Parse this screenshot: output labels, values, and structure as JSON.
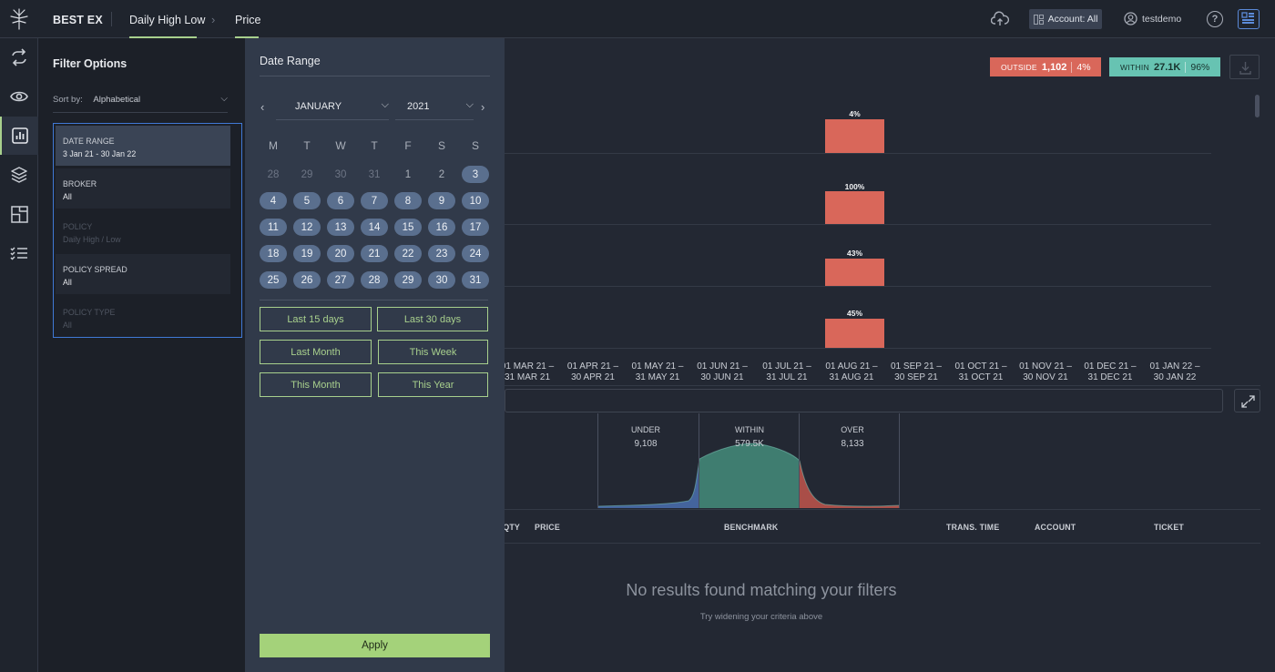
{
  "header": {
    "brand": "BEST EX",
    "breadcrumbs": [
      "Daily High Low",
      "Price"
    ],
    "account_label": "Account: All",
    "username": "testdemo",
    "help": "?"
  },
  "filter_panel": {
    "title": "Filter Options",
    "sort_label": "Sort by:",
    "sort_value": "Alphabetical",
    "items": [
      {
        "label": "DATE RANGE",
        "value": "3 Jan 21 - 30 Jan 22"
      },
      {
        "label": "BROKER",
        "value": "All"
      },
      {
        "label": "POLICY",
        "value": "Daily High / Low"
      },
      {
        "label": "POLICY SPREAD",
        "value": "All"
      },
      {
        "label": "POLICY TYPE",
        "value": "All"
      }
    ]
  },
  "date_range": {
    "title": "Date Range",
    "month": "JANUARY",
    "year": "2021",
    "weekdays": [
      "M",
      "T",
      "W",
      "T",
      "F",
      "S",
      "S"
    ],
    "weeks": [
      [
        "28",
        "29",
        "30",
        "31",
        "1",
        "2",
        "3"
      ],
      [
        "4",
        "5",
        "6",
        "7",
        "8",
        "9",
        "10"
      ],
      [
        "11",
        "12",
        "13",
        "14",
        "15",
        "16",
        "17"
      ],
      [
        "18",
        "19",
        "20",
        "21",
        "22",
        "23",
        "24"
      ],
      [
        "25",
        "26",
        "27",
        "28",
        "29",
        "30",
        "31"
      ]
    ],
    "quick": [
      "Last 15 days",
      "Last 30 days",
      "Last Month",
      "This Week",
      "This Month",
      "This Year"
    ],
    "apply": "Apply"
  },
  "summary": {
    "outside_label": "OUTSIDE",
    "outside_count": "1,102",
    "outside_pct": "4%",
    "within_label": "WITHIN",
    "within_count": "27.1K",
    "within_pct": "96%",
    "outside_color": "#d9675a",
    "within_color": "#67c3b2"
  },
  "chart_data": {
    "type": "bar",
    "bar_color": "#d9675a",
    "bar_labels": [
      "4%",
      "100%",
      "43%",
      "45%"
    ],
    "x_ticks": [
      [
        "01 MAR 21 –",
        "31 MAR 21"
      ],
      [
        "01 APR 21 –",
        "30 APR 21"
      ],
      [
        "01 MAY 21 –",
        "31 MAY 21"
      ],
      [
        "01 JUN 21 –",
        "30 JUN 21"
      ],
      [
        "01 JUL 21 –",
        "31 JUL 21"
      ],
      [
        "01 AUG 21 –",
        "31 AUG 21"
      ],
      [
        "01 SEP 21 –",
        "30 SEP 21"
      ],
      [
        "01 OCT 21 –",
        "31 OCT 21"
      ],
      [
        "01 NOV 21 –",
        "30 NOV 21"
      ],
      [
        "01 DEC 21 –",
        "31 DEC 21"
      ],
      [
        "01 JAN 22 –",
        "30 JAN 22"
      ]
    ]
  },
  "distribution": {
    "under_label": "UNDER",
    "under_value": "9,108",
    "within_label": "WITHIN",
    "within_value": "579.5K",
    "over_label": "OVER",
    "over_value": "8,133",
    "under_color": "#4a6fb0",
    "within_color": "#3f7d70",
    "over_color": "#b8524a"
  },
  "table": {
    "columns": [
      "QTY",
      "PRICE",
      "BENCHMARK",
      "TRANS. TIME",
      "ACCOUNT",
      "TICKET"
    ],
    "empty_title": "No results found matching your filters",
    "empty_hint": "Try widening your criteria above"
  }
}
